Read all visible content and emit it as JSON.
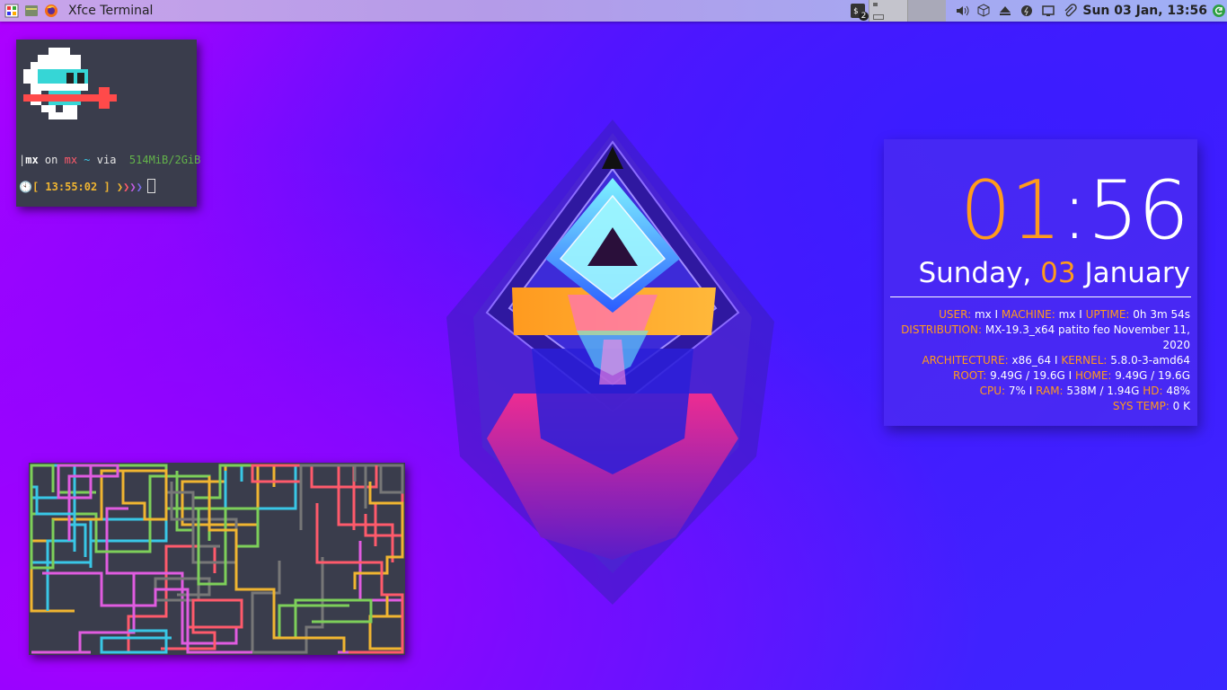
{
  "panel": {
    "window_title": "Xfce Terminal",
    "workspace_badge": "2",
    "datetime": "Sun 03 Jan, 13:56",
    "icons": [
      "app-menu-icon",
      "files-icon",
      "firefox-icon",
      "terminal-tray-icon",
      "volume-icon",
      "package-icon",
      "eject-icon",
      "power-icon",
      "display-icon",
      "clip-icon",
      "update-icon"
    ]
  },
  "terminal": {
    "user": "mx",
    "on": "on",
    "host": "mx",
    "tilde": "~",
    "via": "via",
    "memory": "514MiB/2GiB",
    "time_open": "[",
    "time": "13:55:02",
    "time_close": "]",
    "prompt_arrows": [
      "❯",
      "❯",
      "❯",
      "❯"
    ]
  },
  "conky": {
    "hour": "01",
    "colon": ":",
    "minute": "56",
    "weekday": "Sunday,",
    "day": "03",
    "month": "January",
    "stats": [
      [
        [
          "k",
          "USER:"
        ],
        [
          "v",
          " mx I "
        ],
        [
          "k",
          "MACHINE:"
        ],
        [
          "v",
          " mx I "
        ],
        [
          "k",
          "UPTIME:"
        ],
        [
          "v",
          " 0h 3m 54s"
        ]
      ],
      [
        [
          "k",
          "DISTRIBUTION:"
        ],
        [
          "v",
          " MX-19.3_x64 patito feo November 11, 2020"
        ]
      ],
      [
        [
          "k",
          "ARCHITECTURE:"
        ],
        [
          "v",
          " x86_64 I "
        ],
        [
          "k",
          "KERNEL:"
        ],
        [
          "v",
          " 5.8.0-3-amd64"
        ]
      ],
      [
        [
          "k",
          "ROOT:"
        ],
        [
          "v",
          " 9.49G / 19.6G I "
        ],
        [
          "k",
          "HOME:"
        ],
        [
          "v",
          " 9.49G / 19.6G"
        ]
      ],
      [
        [
          "k",
          "CPU:"
        ],
        [
          "v",
          " 7% I "
        ],
        [
          "k",
          "RAM:"
        ],
        [
          "v",
          " 538M / 1.94G "
        ],
        [
          "k",
          "HD:"
        ],
        [
          "v",
          " 48%"
        ]
      ],
      [
        [
          "k",
          "SYS TEMP:"
        ],
        [
          "v",
          " 0 K"
        ]
      ]
    ]
  },
  "colors": {
    "accent_orange": "#ff9b1c",
    "pipe_colors": [
      "#ff5a6b",
      "#39c7e6",
      "#7dcf5a",
      "#f0b531",
      "#e05ce0",
      "#777777"
    ]
  }
}
